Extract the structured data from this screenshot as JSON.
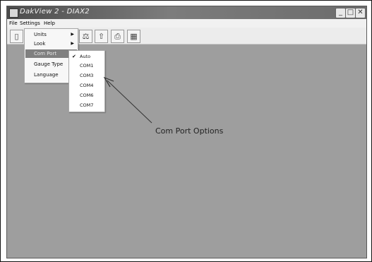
{
  "window": {
    "title": "DakView 2 - DIAX2",
    "controls": [
      "_",
      "□",
      "✕"
    ]
  },
  "menubar": {
    "items": [
      "File",
      "Settings",
      "Help"
    ]
  },
  "toolbar": {
    "icons": [
      "document-icon",
      "weight-icon",
      "weight-up-icon",
      "printer-icon",
      "keypad-icon"
    ]
  },
  "settings_menu": {
    "items": [
      {
        "label": "Units",
        "has_submenu": true
      },
      {
        "label": "Look",
        "has_submenu": true
      },
      {
        "label": "Com Port",
        "has_submenu": true,
        "active": true
      },
      {
        "label": "Gauge Type",
        "has_submenu": true
      },
      {
        "label": "Language",
        "has_submenu": true
      }
    ],
    "submenu_arrow": "▶"
  },
  "com_port_submenu": {
    "items": [
      {
        "label": "Auto",
        "checked": true
      },
      {
        "label": "COM1",
        "checked": false
      },
      {
        "label": "COM3",
        "checked": false
      },
      {
        "label": "COM4",
        "checked": false
      },
      {
        "label": "COM6",
        "checked": false
      },
      {
        "label": "COM7",
        "checked": false
      }
    ],
    "check_glyph": "✔"
  },
  "annotation": {
    "text": "Com Port Options"
  }
}
